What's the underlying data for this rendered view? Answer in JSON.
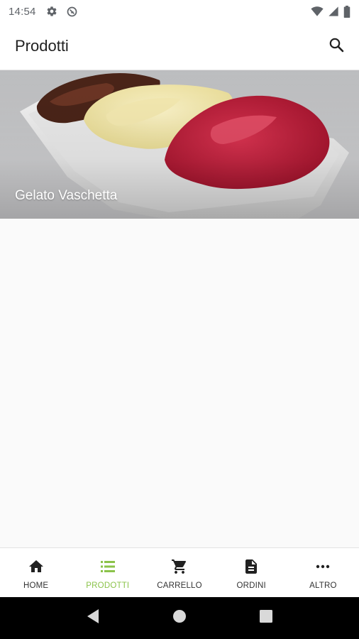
{
  "status_bar": {
    "time": "14:54",
    "icons": [
      "settings-icon",
      "sync-disabled-icon",
      "wifi-icon",
      "signal-icon",
      "battery-icon"
    ]
  },
  "app_bar": {
    "title": "Prodotti",
    "action_icon": "search-icon"
  },
  "products": [
    {
      "name": "Gelato Vaschetta",
      "image": "gelato-tray-photo"
    }
  ],
  "bottom_nav": {
    "active_color": "#8bc34a",
    "items": [
      {
        "label": "HOME",
        "icon": "home-icon",
        "active": false
      },
      {
        "label": "PRODOTTI",
        "icon": "list-icon",
        "active": true
      },
      {
        "label": "CARRELLO",
        "icon": "cart-icon",
        "active": false
      },
      {
        "label": "ORDINI",
        "icon": "document-icon",
        "active": false
      },
      {
        "label": "ALTRO",
        "icon": "more-icon",
        "active": false
      }
    ]
  },
  "system_nav": [
    "back-icon",
    "home-circle-icon",
    "recents-icon"
  ]
}
